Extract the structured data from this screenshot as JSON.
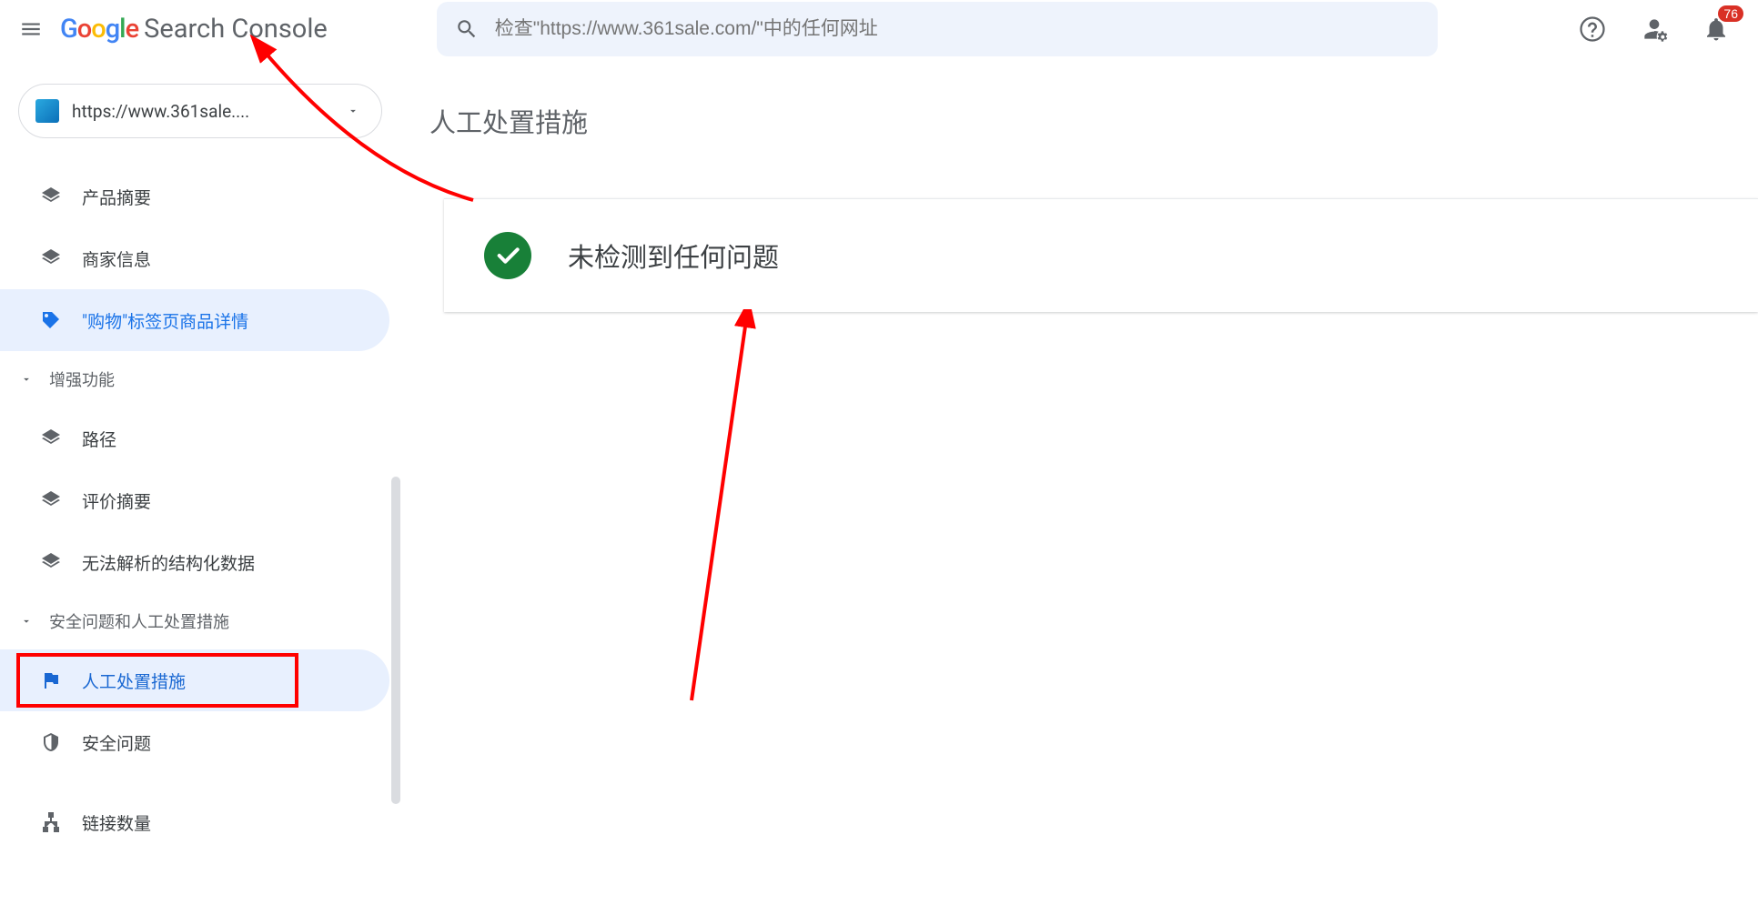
{
  "header": {
    "product_name": "Search Console",
    "search_placeholder": "检查\"https://www.361sale.com/\"中的任何网址",
    "notifications_badge": "76"
  },
  "sidebar": {
    "property_label": "https://www.361sale....",
    "items_top": [
      {
        "label": "产品摘要",
        "icon": "layers"
      },
      {
        "label": "商家信息",
        "icon": "layers"
      },
      {
        "label": "\"购物\"标签页商品详情",
        "icon": "tag"
      }
    ],
    "group_enhance": "增强功能",
    "items_enhance": [
      {
        "label": "路径",
        "icon": "layers"
      },
      {
        "label": "评价摘要",
        "icon": "layers"
      },
      {
        "label": "无法解析的结构化数据",
        "icon": "layers"
      }
    ],
    "group_security": "安全问题和人工处置措施",
    "items_security": [
      {
        "label": "人工处置措施",
        "icon": "flag"
      },
      {
        "label": "安全问题",
        "icon": "shield"
      }
    ],
    "item_links": {
      "label": "链接数量",
      "icon": "sitemap"
    }
  },
  "main": {
    "title": "人工处置措施",
    "status_text": "未检测到任何问题"
  }
}
